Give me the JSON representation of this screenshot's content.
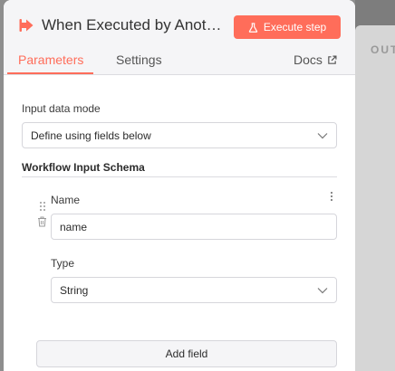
{
  "node": {
    "title": "When Executed by Another Workflow",
    "execute_label": "Execute step",
    "accent_color": "#ff6d5a"
  },
  "tabs": [
    {
      "label": "Parameters",
      "active": true
    },
    {
      "label": "Settings",
      "active": false
    }
  ],
  "docs_label": "Docs",
  "output_panel": {
    "label": "OUT"
  },
  "input_mode": {
    "label": "Input data mode",
    "value": "Define using fields below"
  },
  "schema": {
    "title": "Workflow Input Schema",
    "fields": [
      {
        "name_label": "Name",
        "name_value": "name",
        "type_label": "Type",
        "type_value": "String"
      }
    ],
    "add_field_label": "Add field"
  },
  "icons": {
    "node": "sign-in-icon",
    "execute": "flask-icon",
    "docs": "external-link-icon",
    "drag": "drag-handle-icon",
    "delete": "trash-icon",
    "more": "more-vertical-icon",
    "dropdown": "chevron-down-icon"
  }
}
